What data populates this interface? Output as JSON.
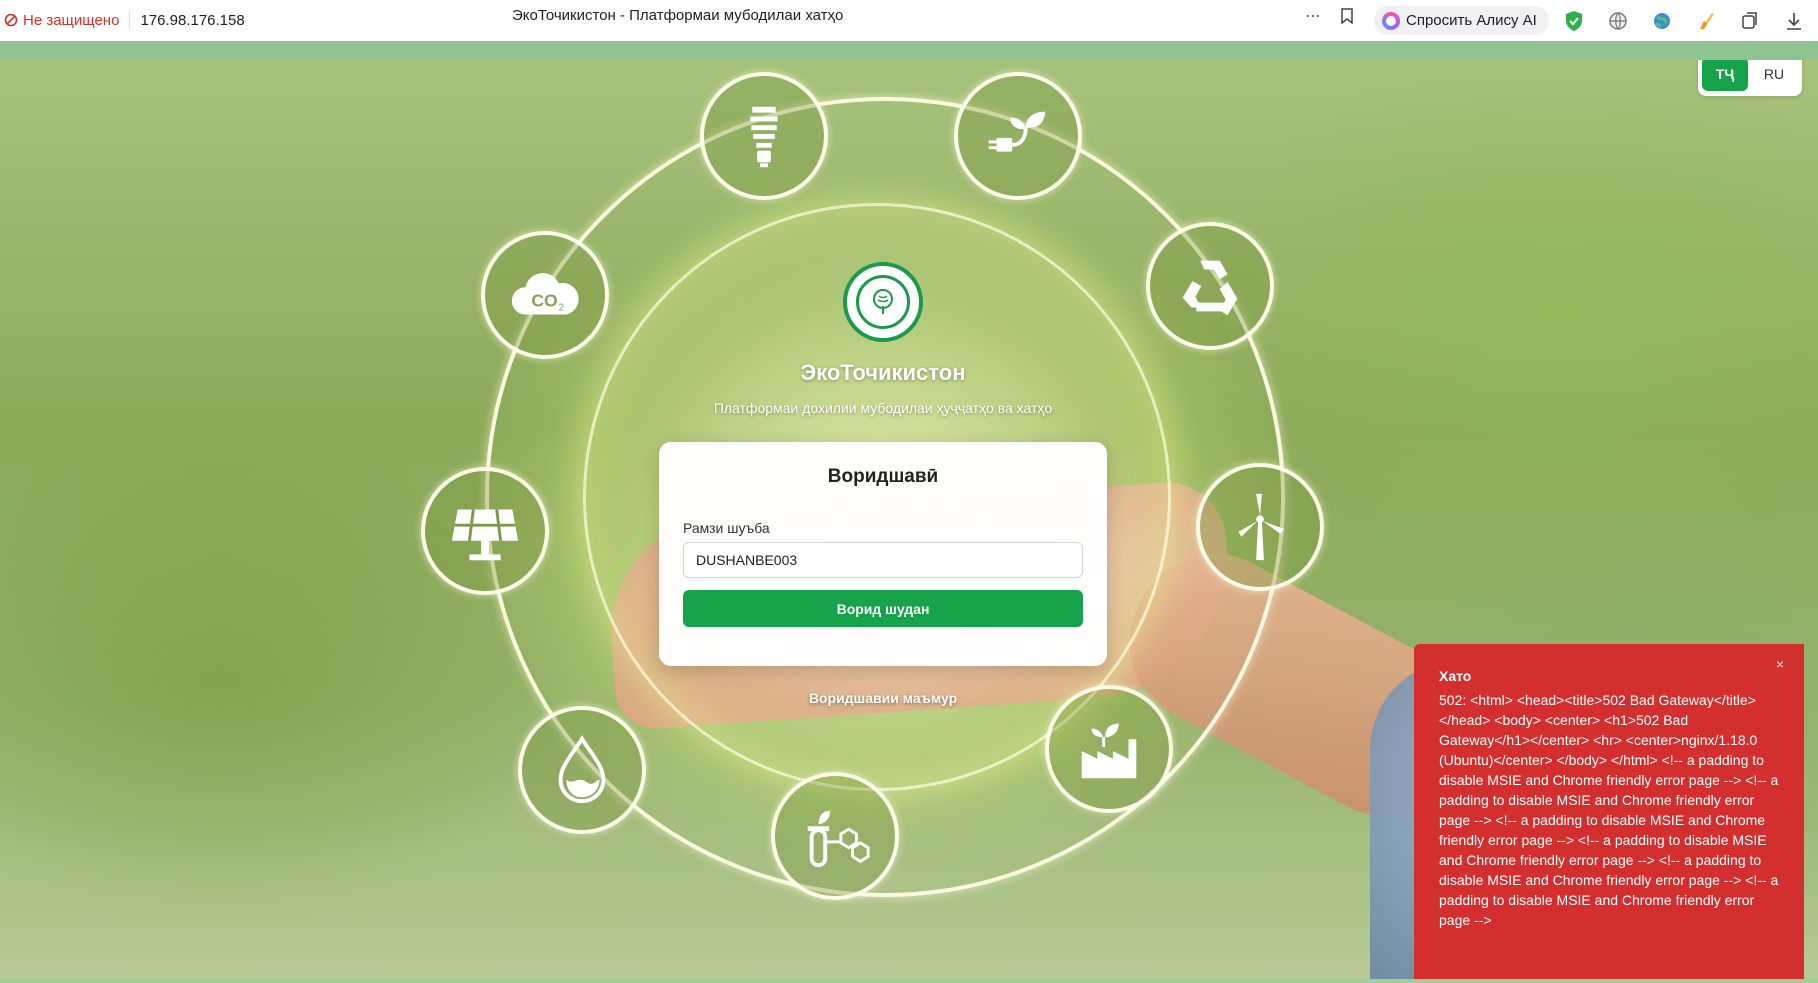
{
  "browser": {
    "security_label": "Не защищено",
    "url": "176.98.176.158",
    "page_title": "ЭкоТочикистон - Платформаи мубодилаи хатҳо",
    "alice_label": "Спросить Алису AI",
    "more_icon": "⋯",
    "bookmark_icon": "bookmark-icon"
  },
  "lang_switch": {
    "active": "ТҶ",
    "other": "RU"
  },
  "brand": {
    "name": "ЭкоТочикистон",
    "tagline": "Платформаи дохилии мубодилаи ҳуҷҷатҳо ва хатҳо"
  },
  "login": {
    "title": "Воридшавӣ",
    "field_label": "Рамзи шуъба",
    "field_value": "DUSHANBE003",
    "submit_label": "Ворид шудан",
    "admin_link": "Воридшавии маъмур"
  },
  "error_toast": {
    "title": "Хато",
    "close_icon": "×",
    "message": "502: <html> <head><title>502 Bad Gateway</title></head> <body> <center> <h1>502 Bad Gateway</h1></center> <hr> <center>nginx/1.18.0 (Ubuntu)</center> </body> </html> <!-- a padding to disable MSIE and Chrome friendly error page --> <!-- a padding to disable MSIE and Chrome friendly error page --> <!-- a padding to disable MSIE and Chrome friendly error page --> <!-- a padding to disable MSIE and Chrome friendly error page --> <!-- a padding to disable MSIE and Chrome friendly error page --> <!-- a padding to disable MSIE and Chrome friendly error page -->"
  },
  "decor_icons": [
    "lightbulb-icon",
    "plug-leaf-icon",
    "recycle-icon",
    "wind-turbine-icon",
    "factory-icon",
    "lab-molecule-icon",
    "water-drop-icon",
    "solar-panel-icon",
    "co2-cloud-icon"
  ],
  "colors": {
    "accent": "#16a34a",
    "error": "#d32f2f",
    "insecure": "#d93025"
  }
}
